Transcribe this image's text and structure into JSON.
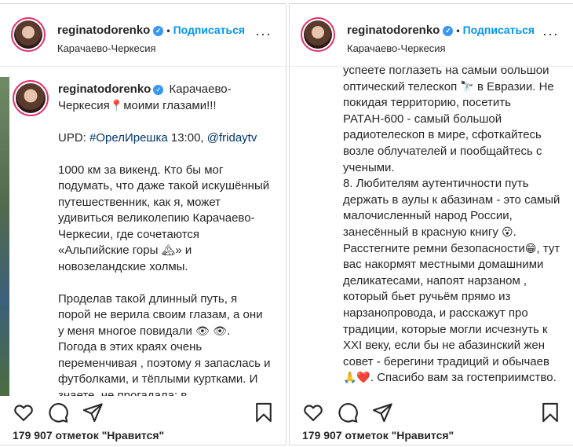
{
  "left": {
    "header": {
      "username": "reginatodorenko",
      "verified": "✓",
      "dot": "•",
      "follow": "Подписаться",
      "location": "Карачаево-Черкесия",
      "more": "···"
    },
    "caption": {
      "username": "reginatodorenko",
      "verified": "✓",
      "intro": "Карачаево-Черкесия",
      "intro_emoji": "📍",
      "intro_end": "моими глазами!!!",
      "upd_prefix": "UPD:",
      "hashtag": "#ОрелИрешка",
      "upd_time": "13:00,",
      "mention": "@fridaytv",
      "p1": "1000 км за викенд. Кто бы мог подумать, что даже такой искушённый путешественник, как я, может удивиться великолепию Карачаево-Черкесии, где сочетаются «Альпийские горы",
      "p1_emoji": "🏔",
      "p1_end": "» и новозеландские холмы.",
      "p2": "Проделав такой длинный путь, я порой не верила своим глазам, а они у меня многое повидали",
      "p2_emoji": "👁 👁.",
      "p3": "Погода в этих краях очень переменчивая , поэтому я запаслась и футболками, и тёплыми куртками. И знаете, не прогадала: в"
    },
    "likes": "179 907 отметок \"Нравится\""
  },
  "right": {
    "header": {
      "username": "reginatodorenko",
      "verified": "✓",
      "dot": "•",
      "follow": "Подписаться",
      "location": "Карачаево-Черкесия",
      "more": "···"
    },
    "caption": {
      "t1": "успеете поглазеть на самый большой оптический телескоп",
      "t1_emoji": "🔭",
      "t1_end": "в Евразии. Не покидая территорию, посетить РАТАН-600 - самый большой радиотелескоп в мире, сфоткайтесь возле облучателей и пообщайтесь с учеными.",
      "t2": "8. Любителям аутентичности путь держать в аулы к абазинам - это самый малочисленный народ России, занесённый в красную книгу",
      "t2_emoji": "😮",
      "t2_mid": ". Расстегните ремни безопасности",
      "t2_emoji2": "😁",
      "t2_end": ", тут вас накормят местными домашними деликатесами, напоят нарзаном , который бьет ручьём прямо из нарзанопровода, и расскажут про традиции, которые могли исчезнуть к XXI веку, если бы не абазинский жен совет - берегини традиций и обычаев",
      "t2_emoji3": "🙏❤️",
      "t2_final": ". Спасибо вам за гостеприимство."
    },
    "likes": "179 907 отметок \"Нравится\""
  },
  "icons": [
    "heart-icon",
    "comment-icon",
    "share-icon",
    "save-icon",
    "verified-icon",
    "more-icon"
  ]
}
